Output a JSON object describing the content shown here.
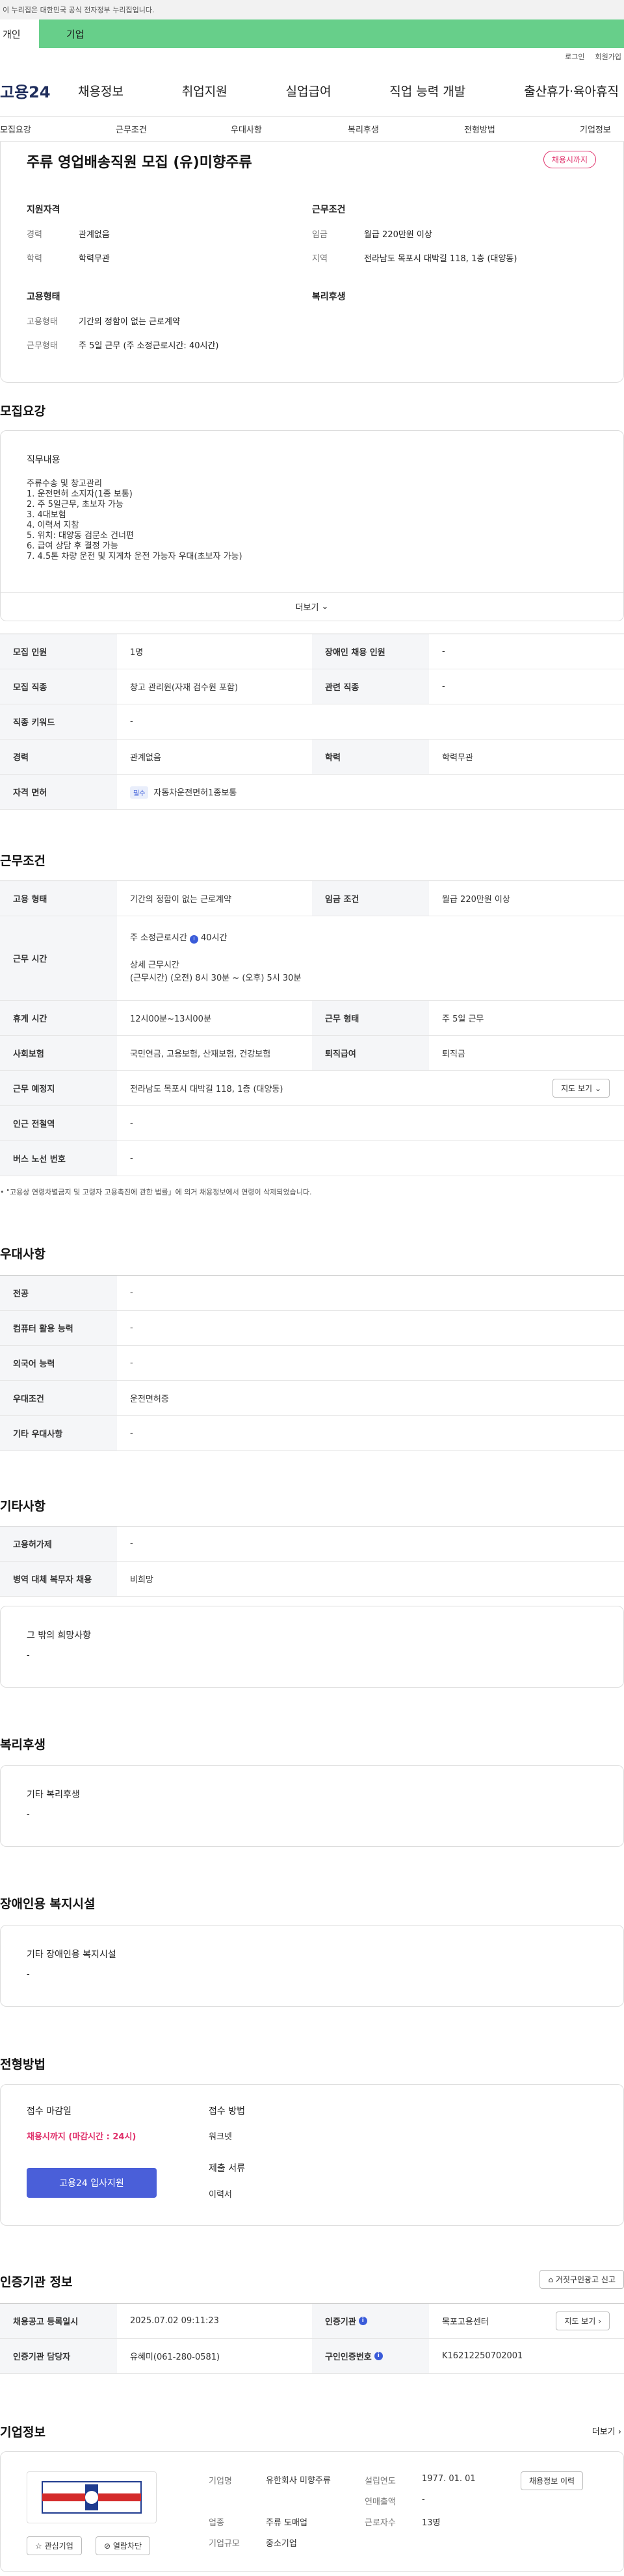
{
  "gov_banner": "이 누리집은 대한민국 공식 전자정부 누리집입니다.",
  "top_tabs": {
    "person": "개인",
    "company": "기업"
  },
  "util": {
    "login": "로그인",
    "join": "회원가입"
  },
  "logo": "고용24",
  "gnb": [
    "채용정보",
    "취업지원",
    "실업급여",
    "직업 능력 개발",
    "출산휴가·육아휴직"
  ],
  "subnav": [
    "모집요강",
    "근무조건",
    "우대사항",
    "복리후생",
    "전형방법",
    "기업정보"
  ],
  "summary": {
    "title": "주류 영업배송직원 모집 (유)미향주류",
    "badge": "채용시까지",
    "qual_h": "지원자격",
    "career_k": "경력",
    "career_v": "관계없음",
    "edu_k": "학력",
    "edu_v": "학력무관",
    "emp_h": "고용형태",
    "emp_k": "고용형태",
    "emp_v": "기간의 정함이 없는 근로계약",
    "work_k": "근무형태",
    "work_v": "주 5일 근무 (주 소정근로시간: 40시간)",
    "cond_h": "근무조건",
    "wage_k": "임금",
    "wage_v": "월급 220만원 이상",
    "area_k": "지역",
    "area_v": "전라남도 목포시 대박길 118, 1층 (대양동)",
    "welfare_h": "복리후생"
  },
  "recruit": {
    "title": "모집요강",
    "duty_h": "직무내용",
    "duty_lines": [
      "주류수송 및 창고관리",
      "1. 운전면허 소지자(1종 보통)",
      "2. 주 5일근무, 초보자 가능",
      "3. 4대보험",
      "4. 이력서 지참",
      "5. 위치: 대양동 검문소 건너편",
      "6. 급여 상담 후 결정 가능",
      "7. 4.5톤 차량 운전 및 지게차 운전 가능자 우대(초보자 가능)"
    ],
    "more": "더보기",
    "rows": {
      "count_k": "모집 인원",
      "count_v": "1명",
      "disabled_k": "장애인 채용 인원",
      "disabled_v": "-",
      "job_k": "모집 직종",
      "job_v": "창고 관리원(자재 검수원 포함)",
      "related_k": "관련 직종",
      "related_v": "-",
      "keyword_k": "직종 키워드",
      "keyword_v": "-",
      "career_k": "경력",
      "career_v": "관계없음",
      "edu_k": "학력",
      "edu_v": "학력무관",
      "license_k": "자격 면허",
      "license_chip": "필수",
      "license_v": "자동차운전면허1종보통"
    }
  },
  "conditions": {
    "title": "근무조건",
    "emp_k": "고용 형태",
    "emp_v": "기간의 정함이 없는 근로계약",
    "wage_k": "임금 조건",
    "wage_v": "월급 220만원 이상",
    "time_k": "근무 시간",
    "time_v1": "주 소정근로시간",
    "time_v1b": "40시간",
    "time_v2": "상세 근무시간",
    "time_v3": "(근무시간) (오전) 8시 30분 ~ (오후) 5시 30분",
    "rest_k": "휴게 시간",
    "rest_v": "12시00분~13시00분",
    "form_k": "근무 형태",
    "form_v": "주 5일 근무",
    "insure_k": "사회보험",
    "insure_v": "국민연금, 고용보험, 산재보험, 건강보험",
    "retire_k": "퇴직급여",
    "retire_v": "퇴직금",
    "place_k": "근무 예정지",
    "place_v": "전라남도 목포시 대박길 118, 1층 (대양동)",
    "map_btn": "지도 보기",
    "subway_k": "인근 전철역",
    "subway_v": "-",
    "bus_k": "버스 노선 번호",
    "bus_v": "-",
    "note": "\"고용상 연령차별금지 및 고령자 고용촉진에 관한 법률」에 의거 채용정보에서 연령이 삭제되었습니다."
  },
  "pref": {
    "title": "우대사항",
    "major_k": "전공",
    "major_v": "-",
    "computer_k": "컴퓨터 활용 능력",
    "computer_v": "-",
    "lang_k": "외국어 능력",
    "lang_v": "-",
    "cond_k": "우대조건",
    "cond_v": "운전면허증",
    "etc_k": "기타 우대사항",
    "etc_v": "-"
  },
  "etc": {
    "title": "기타사항",
    "permit_k": "고용허가제",
    "permit_v": "-",
    "army_k": "병역 대체 복무자 채용",
    "army_v": "비희망",
    "other_h": "그 밖의 희망사항",
    "other_v": "-"
  },
  "welfare": {
    "title": "복리후생",
    "h": "기타 복리후생",
    "v": "-"
  },
  "disability": {
    "title": "장애인용 복지시설",
    "h": "기타 장애인용 복지시설",
    "v": "-"
  },
  "process": {
    "title": "전형방법",
    "deadline_h": "접수 마감일",
    "deadline_v": "채용시까지 (마감시간 : 24시)",
    "apply_btn": "고용24 입사지원",
    "method_h": "접수 방법",
    "method_v": "워크넷",
    "docs_h": "제출 서류",
    "docs_v": "이력서"
  },
  "agency": {
    "title": "인증기관 정보",
    "report_btn": "거짓구인광고 신고",
    "reg_k": "채용공고 등록일시",
    "reg_v": "2025.07.02 09:11:23",
    "org_k": "인증기관",
    "org_v": "목포고용센터",
    "map_btn": "지도 보기",
    "staff_k": "인증기관 담당자",
    "staff_v": "유혜미(061-280-0581)",
    "num_k": "구인인증번호",
    "num_v": "K16212250702001"
  },
  "company": {
    "title": "기업정보",
    "more": "더보기",
    "fav_btn": "관심기업",
    "block_btn": "열람차단",
    "name_k": "기업명",
    "name_v": "유한회사 미향주류",
    "year_k": "설립연도",
    "year_v": "1977. 01. 01",
    "history_btn": "채용정보 이력",
    "sales_k": "연매출액",
    "sales_v": "-",
    "ind_k": "업종",
    "ind_v": "주류 도매업",
    "emp_k": "근로자수",
    "emp_v": "13명",
    "size_k": "기업규모",
    "size_v": "중소기업"
  },
  "colors": {
    "accent": "#4a5fd9",
    "company_tab": "#67cf8a",
    "badge": "#e0316b"
  }
}
